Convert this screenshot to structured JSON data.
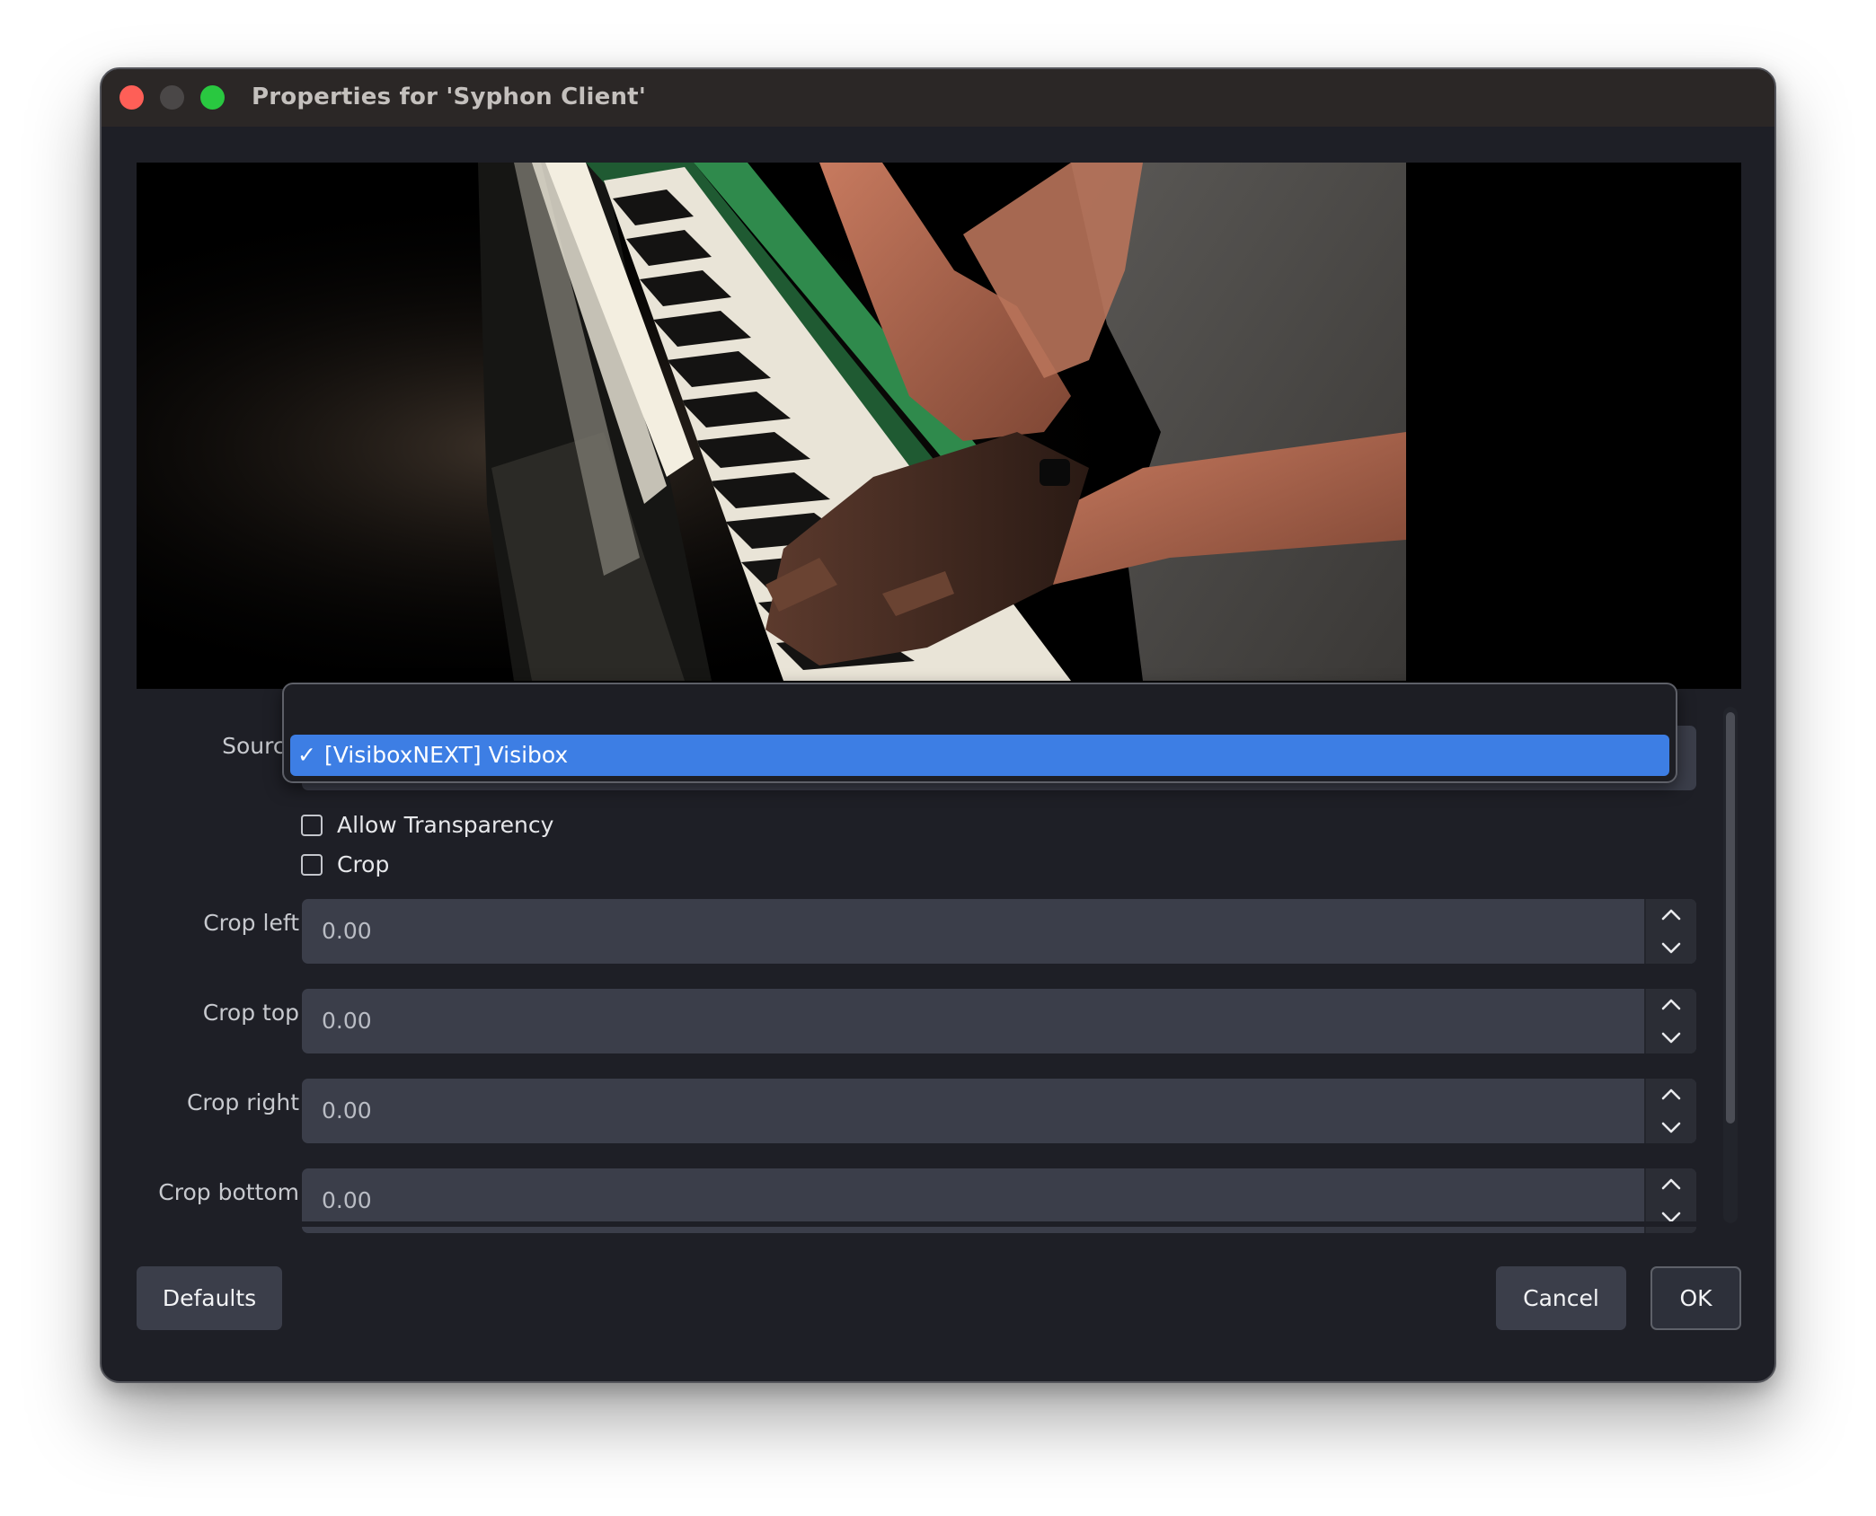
{
  "window": {
    "title": "Properties for 'Syphon Client'"
  },
  "form": {
    "source_label": "Source",
    "source_value": "[VisiboxNEXT] Visibox",
    "checkboxes": [
      {
        "label": "Allow Transparency",
        "checked": false
      },
      {
        "label": "Crop",
        "checked": false
      }
    ],
    "crop_fields": [
      {
        "label": "Crop left",
        "value": "0.00"
      },
      {
        "label": "Crop top",
        "value": "0.00"
      },
      {
        "label": "Crop right",
        "value": "0.00"
      },
      {
        "label": "Crop bottom",
        "value": "0.00"
      }
    ]
  },
  "dropdown": {
    "selected_mark": "✓",
    "items": [
      {
        "label": "[VisiboxNEXT] Visibox",
        "selected": true
      }
    ]
  },
  "buttons": {
    "defaults": "Defaults",
    "cancel": "Cancel",
    "ok": "OK"
  },
  "colors": {
    "window_bg": "#1e1f26",
    "titlebar_bg": "#2b2726",
    "field_bg": "#3b3e4a",
    "selection": "#3d7ee4",
    "close": "#fe5f57",
    "minimize": "#4a4747",
    "zoom": "#29c840"
  },
  "icons": {
    "stepper_up": "chevron-up-icon",
    "stepper_down": "chevron-down-icon",
    "check": "checkmark-icon"
  }
}
